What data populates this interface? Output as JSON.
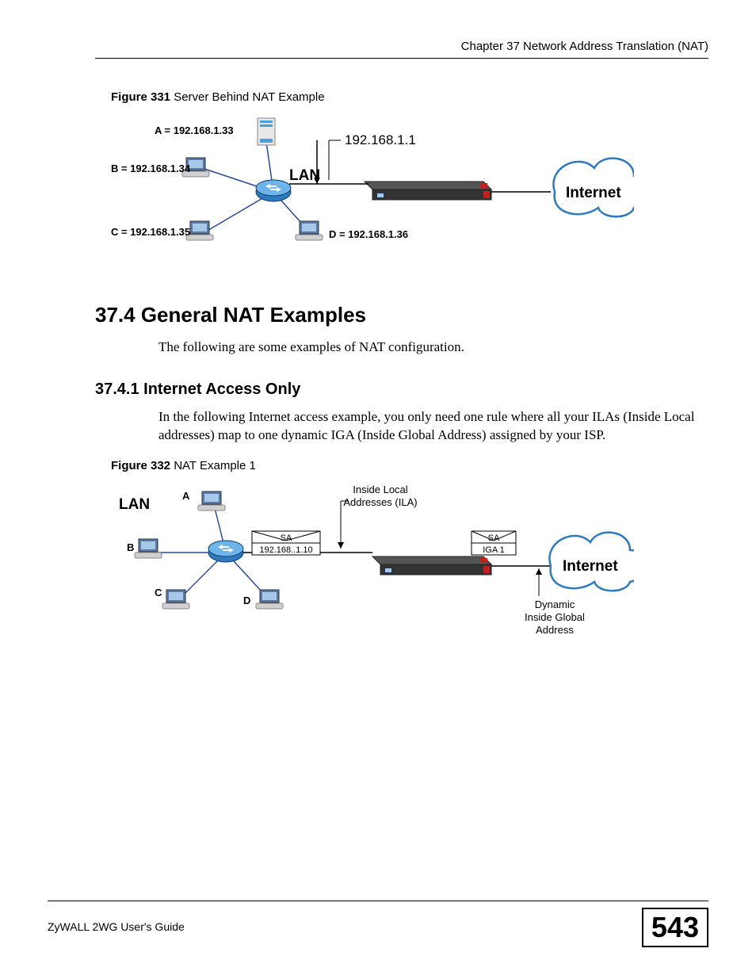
{
  "header": {
    "chapter": "Chapter 37 Network Address Translation (NAT)"
  },
  "figure331": {
    "label_bold": "Figure 331",
    "label_rest": "   Server Behind NAT Example",
    "nodeA": "A = 192.168.1.33",
    "nodeB": "B = 192.168.1.34",
    "nodeC": "C = 192.168.1.35",
    "nodeD": "D = 192.168.1.36",
    "gateway_ip": "192.168.1.1",
    "lan_label": "LAN",
    "internet_label": "Internet"
  },
  "section": {
    "number_title": "37.4  General NAT Examples",
    "intro": "The following are some examples of NAT configuration."
  },
  "subsection": {
    "number_title": "37.4.1  Internet Access Only",
    "para": "In the following Internet access example, you only need one rule where all your ILAs (Inside Local addresses) map to one dynamic IGA (Inside Global Address) assigned by your ISP."
  },
  "figure332": {
    "label_bold": "Figure 332",
    "label_rest": "   NAT Example 1",
    "lan_label": "LAN",
    "nodeA": "A",
    "nodeB": "B",
    "nodeC": "C",
    "nodeD": "D",
    "envelope1_top": "SA",
    "envelope1_bottom": "192.168..1.10",
    "envelope2_top": "SA",
    "envelope2_bottom": "IGA 1",
    "ila_label_line1": "Inside Local",
    "ila_label_line2": "Addresses (ILA)",
    "internet_label": "Internet",
    "iga_label_line1": "Dynamic",
    "iga_label_line2": "Inside Global",
    "iga_label_line3": "Address"
  },
  "footer": {
    "guide": "ZyWALL 2WG User's Guide",
    "page": "543"
  }
}
